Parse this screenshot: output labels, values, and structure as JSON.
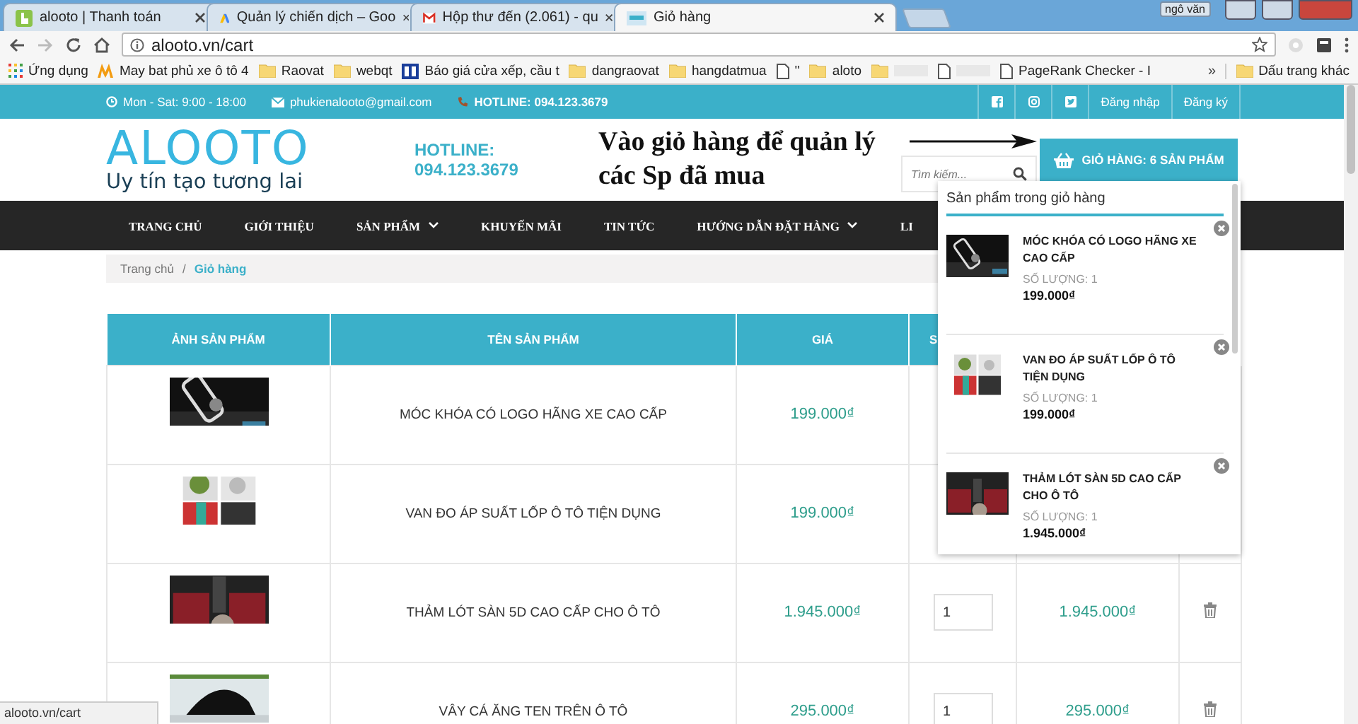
{
  "browser": {
    "tabs": [
      {
        "title": "alooto | Thanh toán",
        "selected": false
      },
      {
        "title": "Quản lý chiến dịch – Goo",
        "selected": false
      },
      {
        "title": "Hộp thư đến (2.061) - qu",
        "selected": false
      },
      {
        "title": "Giỏ hàng",
        "selected": true
      }
    ],
    "user": "ngô văn",
    "address": "alooto.vn/cart",
    "bookmarks": [
      {
        "label": "Ứng dụng",
        "kind": "apps"
      },
      {
        "label": "May bat phủ xe ô tô 4",
        "kind": "m"
      },
      {
        "label": "Raovat",
        "kind": "folder"
      },
      {
        "label": "webqt",
        "kind": "folder"
      },
      {
        "label": "Báo giá cửa xếp, cầu t",
        "kind": "rb"
      },
      {
        "label": "dangraovat",
        "kind": "folder"
      },
      {
        "label": "hangdatmua",
        "kind": "folder"
      },
      {
        "label": "''",
        "kind": "page"
      },
      {
        "label": "aloto",
        "kind": "folder"
      },
      {
        "kind": "folder"
      },
      {
        "kind": "page"
      },
      {
        "label": "PageRank Checker - I",
        "kind": "page"
      }
    ],
    "bookmarks_overflow": "»",
    "other_bookmarks": "Dấu trang khác"
  },
  "topbar": {
    "hours": "Mon - Sat: 9:00 - 18:00",
    "email": "phukienalooto@gmail.com",
    "hotline": "HOTLINE: 094.123.3679",
    "social": [
      {
        "kind": "facebook"
      },
      {
        "kind": "instagram"
      },
      {
        "kind": "twitter"
      }
    ],
    "links": [
      "Đăng nhập",
      "Đăng ký"
    ]
  },
  "header": {
    "logo": "ALOOTO",
    "tagline": "Uy tín tạo tương lai",
    "hotline": "HOTLINE: 094.123.3679",
    "search_placeholder": "Tìm kiếm...",
    "cart_button": "GIỎ HÀNG: 6 SẢN PHẨM"
  },
  "annotation": "Vào giỏ hàng để quản lý các Sp đã mua",
  "nav": [
    {
      "label": "TRANG CHỦ",
      "dropdown": false
    },
    {
      "label": "GIỚI THIỆU",
      "dropdown": false
    },
    {
      "label": "SẢN PHẨM",
      "dropdown": true
    },
    {
      "label": "KHUYẾN MÃI",
      "dropdown": false
    },
    {
      "label": "TIN TỨC",
      "dropdown": false
    },
    {
      "label": "HƯỚNG DẪN ĐẶT HÀNG",
      "dropdown": true
    },
    {
      "label": "LI",
      "dropdown": false
    }
  ],
  "breadcrumb_separator": "/",
  "breadcrumb": [
    {
      "label": "Trang chủ",
      "selected": false
    },
    {
      "label": "Giỏ hàng",
      "selected": true
    }
  ],
  "table": {
    "columns": [
      "ẢNH SẢN PHẨM",
      "TÊN SẢN PHẨM",
      "GIÁ",
      "S"
    ],
    "rows": [
      {
        "name": "MÓC KHÓA CÓ LOGO HÃNG XE CAO CẤP",
        "price": "199.000₫"
      },
      {
        "name": "VAN ĐO ÁP SUẤT LỐP Ô TÔ TIỆN DỤNG",
        "price": "199.000₫"
      },
      {
        "name": "THẢM LÓT SÀN 5D CAO CẤP CHO Ô TÔ",
        "price": "1.945.000₫",
        "quantity": "1",
        "subtotal": "1.945.000₫"
      },
      {
        "name": "VÂY CÁ ĂNG TEN TRÊN Ô TÔ",
        "price": "295.000₫",
        "quantity": "1",
        "subtotal": "295.000₫"
      }
    ]
  },
  "cart_popup": {
    "title": "Sản phẩm trong giỏ hàng",
    "items": [
      {
        "name": "MÓC KHÓA CÓ LOGO HÃNG XE CAO CẤP",
        "quantity": "SỐ LƯỢNG: 1",
        "price": "199.000₫"
      },
      {
        "name": "VAN ĐO ÁP SUẤT LỐP Ô TÔ TIỆN DỤNG",
        "quantity": "SỐ LƯỢNG: 1",
        "price": "199.000₫"
      },
      {
        "name": "THẢM LÓT SÀN 5D CAO CẤP CHO Ô TÔ",
        "quantity": "SỐ LƯỢNG: 1",
        "price": "1.945.000₫"
      }
    ]
  },
  "status_bar": "alooto.vn/cart"
}
